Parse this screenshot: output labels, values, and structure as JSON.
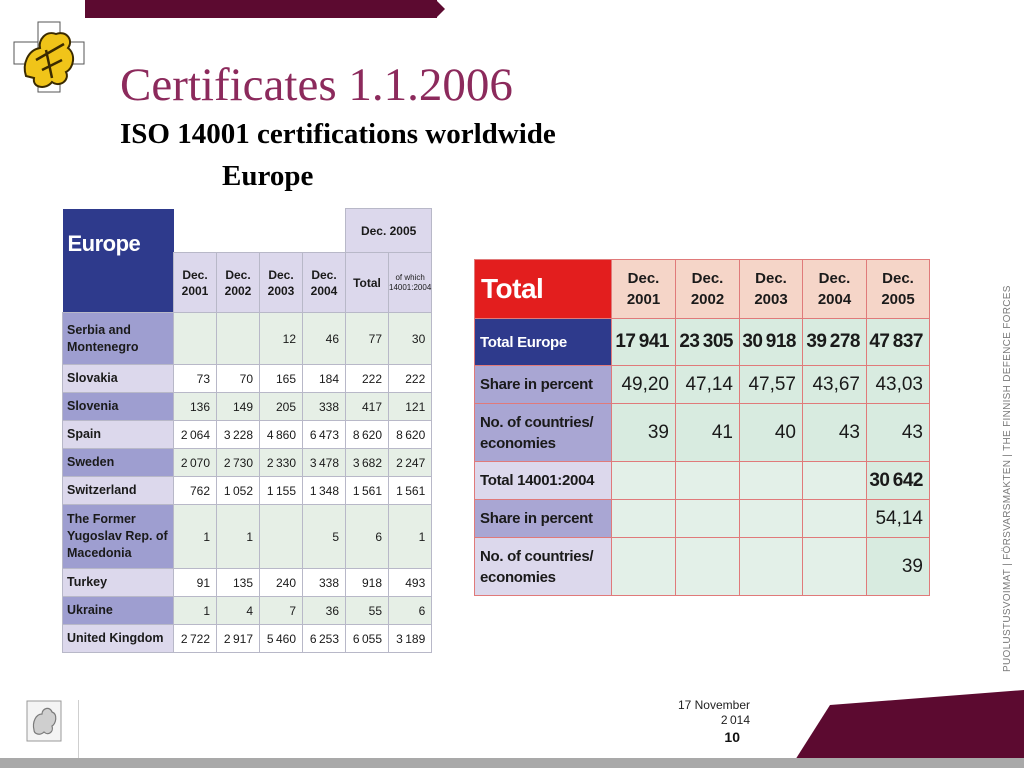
{
  "slide": {
    "title": "Certificates 1.1.2006",
    "subtitle": "ISO 14001 certifications worldwide",
    "region": "Europe",
    "side_text": "PUOLUSTUSVOIMAT  |  FÖRSVARSMAKTEN  |  THE FINNISH DEFENCE FORCES",
    "date_line1": "17 November",
    "date_line2": "2014",
    "page_number": "10",
    "colors": {
      "accent": "#5c0a30",
      "title": "#8c2a5c",
      "eu_header": "#2e3a8c",
      "total_header": "#e31e1e"
    }
  },
  "europe_table": {
    "header_title": "Europe",
    "years": [
      "Dec. 2001",
      "Dec. 2002",
      "Dec. 2003",
      "Dec. 2004"
    ],
    "group_label": "Dec. 2005",
    "sub_total": "Total",
    "sub_of_which": "of which 14001:2004",
    "rows": [
      {
        "country": "Serbia and Montenegro",
        "v": [
          "",
          "",
          "12",
          "46",
          "77",
          "30"
        ]
      },
      {
        "country": "Slovakia",
        "v": [
          "73",
          "70",
          "165",
          "184",
          "222",
          "222"
        ]
      },
      {
        "country": "Slovenia",
        "v": [
          "136",
          "149",
          "205",
          "338",
          "417",
          "121"
        ]
      },
      {
        "country": "Spain",
        "v": [
          "2064",
          "3228",
          "4860",
          "6473",
          "8620",
          "8620"
        ]
      },
      {
        "country": "Sweden",
        "v": [
          "2070",
          "2730",
          "2330",
          "3478",
          "3682",
          "2247"
        ]
      },
      {
        "country": "Switzerland",
        "v": [
          "762",
          "1052",
          "1155",
          "1348",
          "1561",
          "1561"
        ]
      },
      {
        "country": "The Former Yugoslav Rep. of Macedonia",
        "v": [
          "1",
          "1",
          "",
          "5",
          "6",
          "1"
        ]
      },
      {
        "country": "Turkey",
        "v": [
          "91",
          "135",
          "240",
          "338",
          "918",
          "493"
        ]
      },
      {
        "country": "Ukraine",
        "v": [
          "1",
          "4",
          "7",
          "36",
          "55",
          "6"
        ]
      },
      {
        "country": "United Kingdom",
        "v": [
          "2722",
          "2917",
          "5460",
          "6253",
          "6055",
          "3189"
        ]
      }
    ]
  },
  "total_table": {
    "header_title": "Total",
    "years": [
      "Dec. 2001",
      "Dec. 2002",
      "Dec. 2003",
      "Dec. 2004",
      "Dec. 2005"
    ],
    "rows": [
      {
        "label": "Total Europe",
        "v": [
          "17941",
          "23305",
          "30918",
          "39278",
          "47837"
        ]
      },
      {
        "label": "Share in percent",
        "v": [
          "49,20",
          "47,14",
          "47,57",
          "43,67",
          "43,03"
        ]
      },
      {
        "label": "No. of countries/ economies",
        "v": [
          "39",
          "41",
          "40",
          "43",
          "43"
        ]
      },
      {
        "label": "Total 14001:2004",
        "v": [
          "",
          "",
          "",
          "",
          "30642"
        ]
      },
      {
        "label": "Share in percent",
        "v": [
          "",
          "",
          "",
          "",
          "54,14"
        ]
      },
      {
        "label": "No. of countries/ economies",
        "v": [
          "",
          "",
          "",
          "",
          "39"
        ]
      }
    ]
  }
}
